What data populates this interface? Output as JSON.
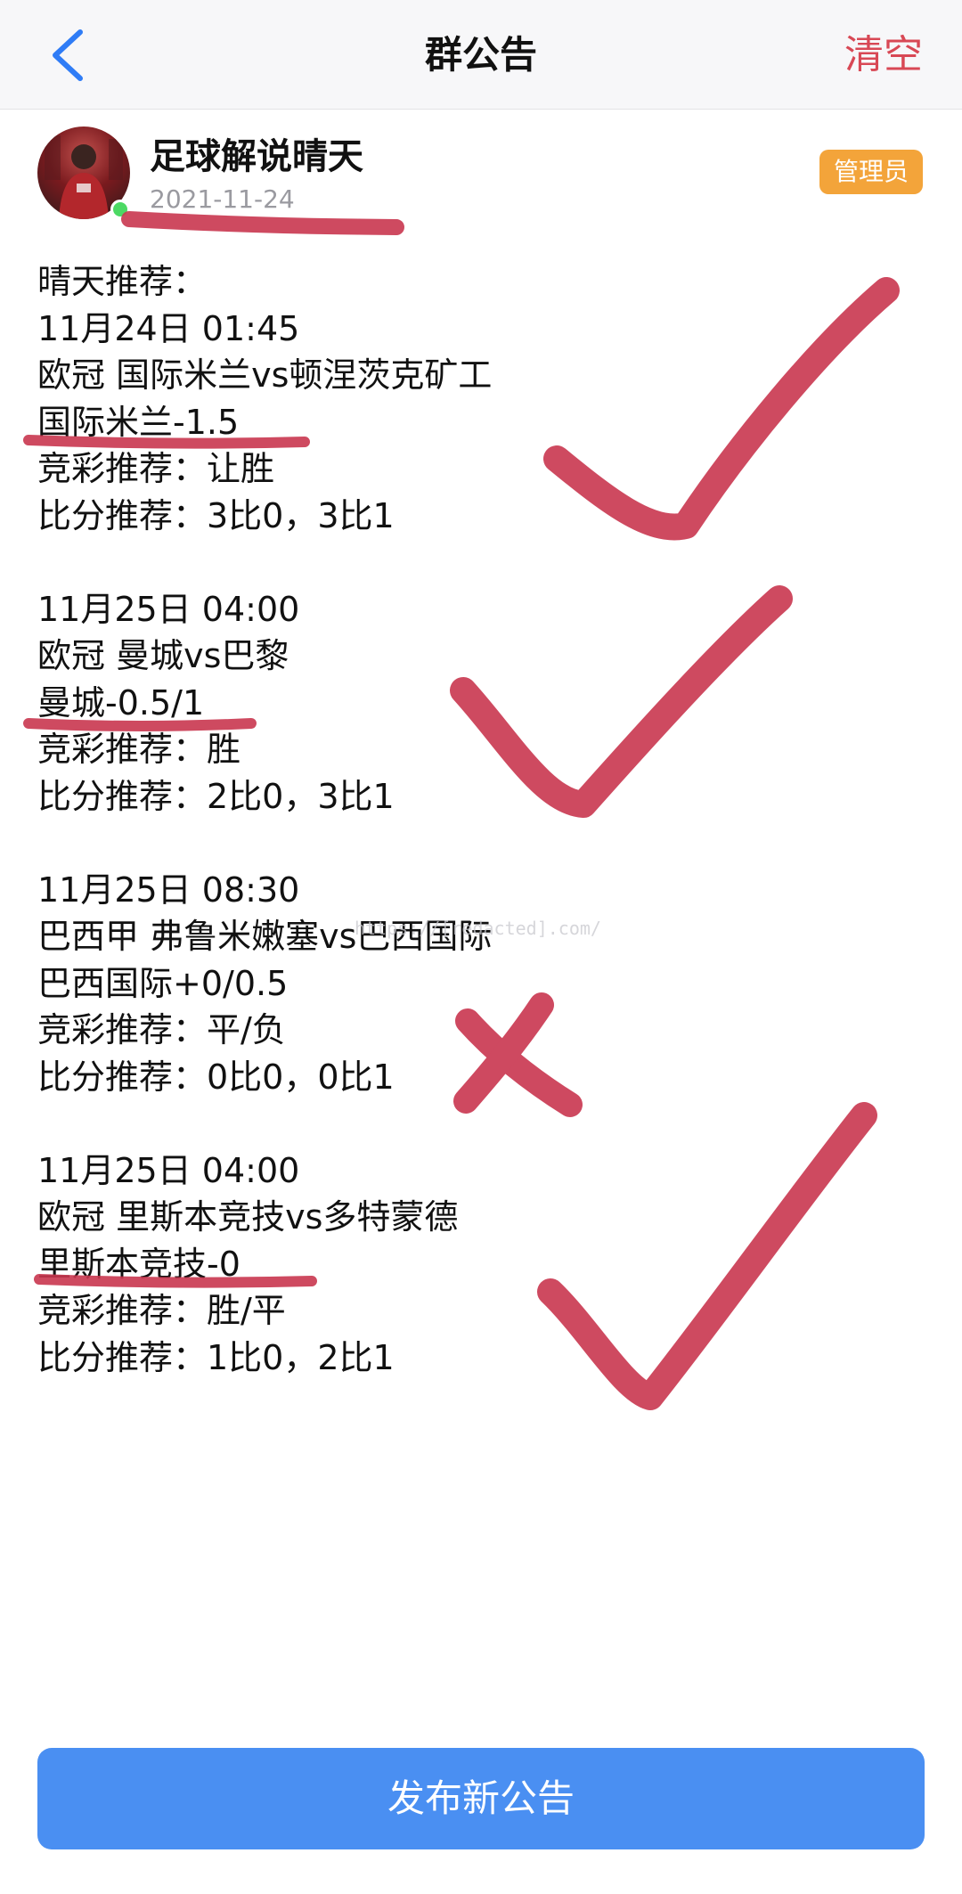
{
  "header": {
    "title": "群公告",
    "clear_label": "清空"
  },
  "poster": {
    "name": "足球解说晴天",
    "date": "2021-11-24",
    "role_badge": "管理员"
  },
  "announcement": {
    "intro": "晴天推荐：",
    "matches": [
      {
        "time": "11月24日 01:45",
        "fixture": "欧冠 国际米兰vs顿涅茨克矿工",
        "handicap": "国际米兰-1.5",
        "lottery_pick": "竞彩推荐：让胜",
        "score_pick": "比分推荐：3比0，3比1",
        "mark": "check"
      },
      {
        "time": "11月25日 04:00",
        "fixture": "欧冠 曼城vs巴黎",
        "handicap": "曼城-0.5/1",
        "lottery_pick": "竞彩推荐：胜",
        "score_pick": "比分推荐：2比0，3比1",
        "mark": "check"
      },
      {
        "time": "11月25日 08:30",
        "fixture": "巴西甲 弗鲁米嫩塞vs巴西国际",
        "handicap": "巴西国际+0/0.5",
        "lottery_pick": "竞彩推荐：平/负",
        "score_pick": "比分推荐：0比0，0比1",
        "mark": "cross"
      },
      {
        "time": "11月25日 04:00",
        "fixture": "欧冠 里斯本竞技vs多特蒙德",
        "handicap": "里斯本竞技-0",
        "lottery_pick": "竞彩推荐：胜/平",
        "score_pick": "比分推荐：1比0，2比1",
        "mark": "check"
      }
    ]
  },
  "watermark": "https://[redacted].com/",
  "colors": {
    "accent_red": "#d84855",
    "button_blue": "#4a8ff2",
    "badge_orange": "#f3a43a",
    "online_green": "#4cd964",
    "marker_red": "#c9364f"
  },
  "icons": {
    "back": "chevron-left-icon",
    "online": "online-dot-icon"
  },
  "footer": {
    "publish_label": "发布新公告"
  }
}
